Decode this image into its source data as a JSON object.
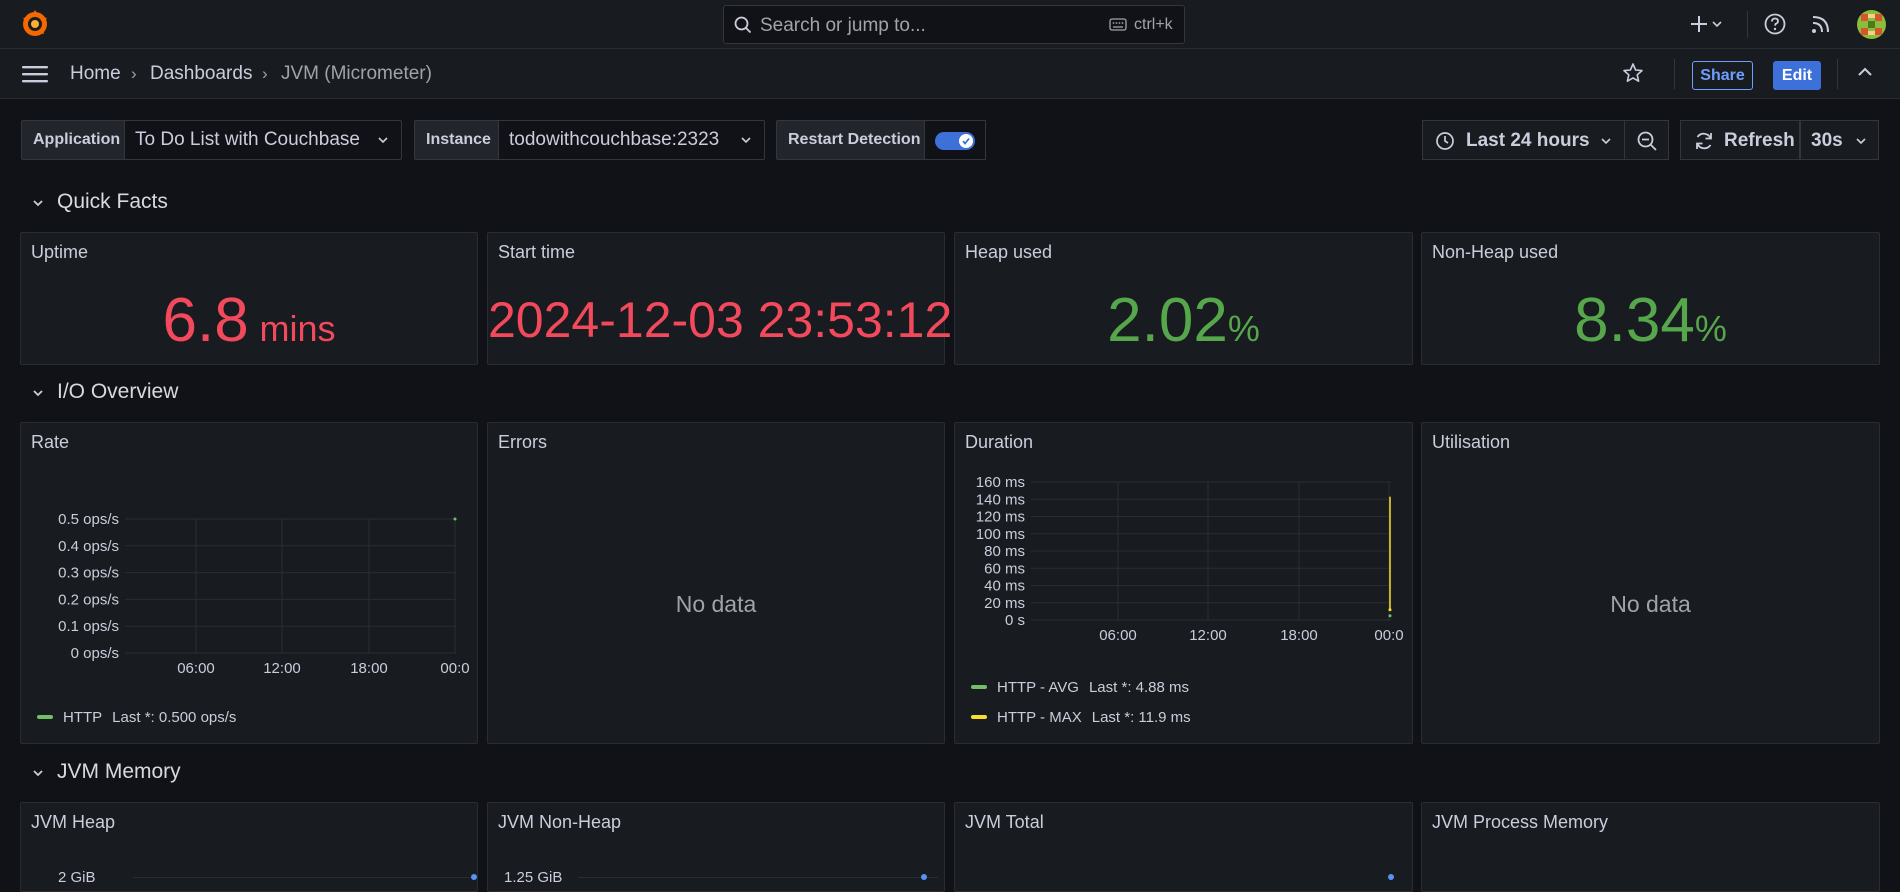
{
  "topbar": {
    "search_placeholder": "Search or jump to...",
    "search_shortcut": "ctrl+k",
    "icons": [
      "grafana-logo",
      "search-icon",
      "keyboard-icon",
      "plus-icon",
      "help-icon",
      "news-icon",
      "avatar"
    ]
  },
  "breadcrumb": {
    "home": "Home",
    "dashboards": "Dashboards",
    "current": "JVM (Micrometer)",
    "separator": "›"
  },
  "nav_actions": {
    "share": "Share",
    "edit": "Edit"
  },
  "variables": {
    "application": {
      "label": "Application",
      "value": "To Do List with Couchbase"
    },
    "instance": {
      "label": "Instance",
      "value": "todowithcouchbase:2323"
    },
    "restart_detection": {
      "label": "Restart Detection",
      "enabled": true
    }
  },
  "time_controls": {
    "range": "Last 24 hours",
    "refresh_label": "Refresh",
    "refresh_interval": "30s"
  },
  "rows": {
    "quick_facts": "Quick Facts",
    "io_overview": "I/O Overview",
    "jvm_memory": "JVM Memory"
  },
  "stats": {
    "uptime": {
      "title": "Uptime",
      "value": "6.8",
      "unit": "mins",
      "color": "#f2495c"
    },
    "start_time": {
      "title": "Start time",
      "value": "2024-12-03 23:53:12",
      "color": "#f2495c"
    },
    "heap_used": {
      "title": "Heap used",
      "value": "2.02",
      "unit": "%",
      "color": "#56a64b"
    },
    "non_heap_used": {
      "title": "Non-Heap used",
      "value": "8.34",
      "unit": "%",
      "color": "#56a64b"
    }
  },
  "panels": {
    "rate": {
      "title": "Rate"
    },
    "errors": {
      "title": "Errors",
      "no_data": "No data"
    },
    "duration": {
      "title": "Duration"
    },
    "utilisation": {
      "title": "Utilisation",
      "no_data": "No data"
    },
    "jvm_heap": {
      "title": "JVM Heap",
      "partial_tick": "2 GiB"
    },
    "jvm_non_heap": {
      "title": "JVM Non-Heap",
      "partial_tick": "1.25 GiB"
    },
    "jvm_total": {
      "title": "JVM Total"
    },
    "jvm_process_memory": {
      "title": "JVM Process Memory"
    }
  },
  "chart_data": [
    {
      "type": "line",
      "title": "Rate",
      "x_ticks": [
        "06:00",
        "12:00",
        "18:00",
        "00:0"
      ],
      "y_ticks": [
        "0 ops/s",
        "0.1 ops/s",
        "0.2 ops/s",
        "0.3 ops/s",
        "0.4 ops/s",
        "0.5 ops/s"
      ],
      "ylim": [
        0,
        0.5
      ],
      "series": [
        {
          "name": "HTTP",
          "legend_value": "Last *: 0.500 ops/s",
          "color": "#73bf69",
          "values": [
            0.5
          ]
        }
      ],
      "legend_position": "bottom-left"
    },
    {
      "type": "line",
      "title": "Duration",
      "x_ticks": [
        "06:00",
        "12:00",
        "18:00",
        "00:0"
      ],
      "y_ticks": [
        "0 s",
        "20 ms",
        "40 ms",
        "60 ms",
        "80 ms",
        "100 ms",
        "120 ms",
        "140 ms",
        "160 ms"
      ],
      "ylim": [
        0,
        160
      ],
      "series": [
        {
          "name": "HTTP - AVG",
          "legend_value": "Last *: 4.88 ms",
          "color": "#73bf69",
          "values": [
            4.88
          ]
        },
        {
          "name": "HTTP - MAX",
          "legend_value": "Last *: 11.9 ms",
          "color": "#fade2a",
          "values": [
            143,
            11.9
          ]
        }
      ],
      "legend_position": "bottom-left"
    }
  ]
}
